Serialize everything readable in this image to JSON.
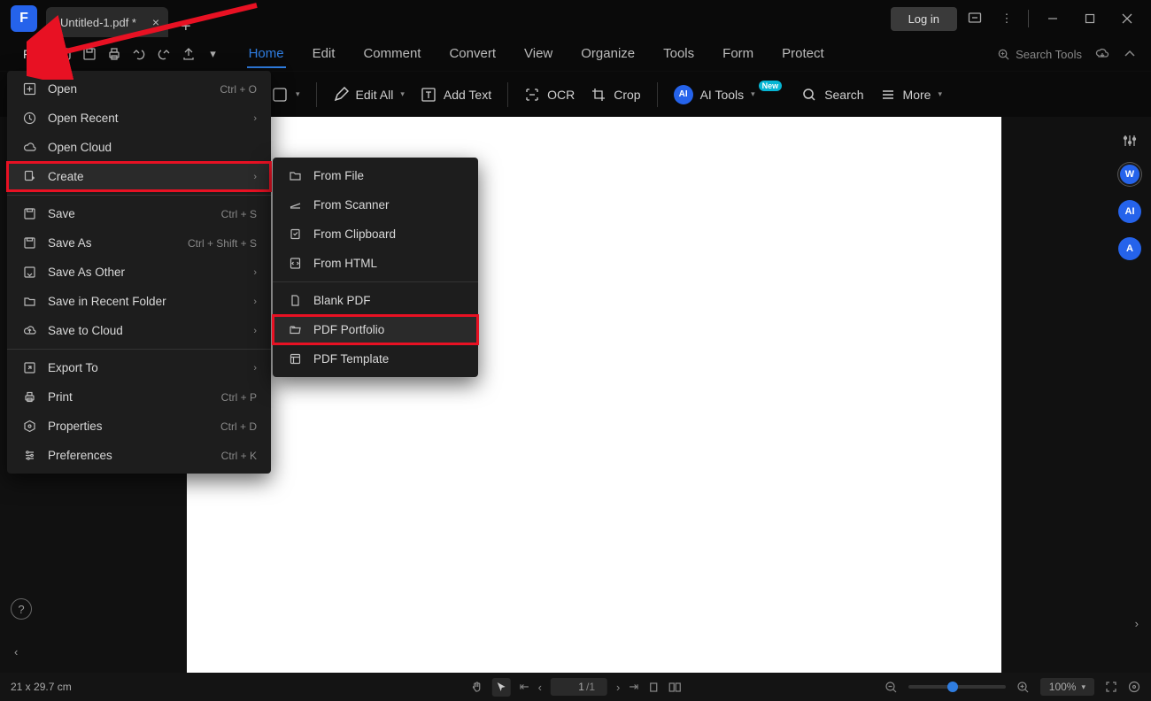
{
  "app": {
    "logo_letter": "F"
  },
  "tab": {
    "title": "Untitled-1.pdf *"
  },
  "titlebar": {
    "login": "Log in"
  },
  "menu": {
    "file": "File"
  },
  "ribbon": {
    "home": "Home",
    "edit": "Edit",
    "comment": "Comment",
    "convert": "Convert",
    "view": "View",
    "organize": "Organize",
    "tools": "Tools",
    "form": "Form",
    "protect": "Protect"
  },
  "search": {
    "placeholder": "Search Tools"
  },
  "toolbar": {
    "edit_all": "Edit All",
    "add_text": "Add Text",
    "ocr": "OCR",
    "crop": "Crop",
    "ai_tools": "AI Tools",
    "new_badge": "New",
    "search": "Search",
    "more": "More"
  },
  "file_menu": {
    "open": {
      "label": "Open",
      "shortcut": "Ctrl + O"
    },
    "open_recent": {
      "label": "Open Recent"
    },
    "open_cloud": {
      "label": "Open Cloud"
    },
    "create": {
      "label": "Create"
    },
    "save": {
      "label": "Save",
      "shortcut": "Ctrl + S"
    },
    "save_as": {
      "label": "Save As",
      "shortcut": "Ctrl + Shift + S"
    },
    "save_as_other": {
      "label": "Save As Other"
    },
    "save_recent_folder": {
      "label": "Save in Recent Folder"
    },
    "save_cloud": {
      "label": "Save to Cloud"
    },
    "export_to": {
      "label": "Export To"
    },
    "print": {
      "label": "Print",
      "shortcut": "Ctrl + P"
    },
    "properties": {
      "label": "Properties",
      "shortcut": "Ctrl + D"
    },
    "preferences": {
      "label": "Preferences",
      "shortcut": "Ctrl + K"
    }
  },
  "create_menu": {
    "from_file": "From File",
    "from_scanner": "From Scanner",
    "from_clipboard": "From Clipboard",
    "from_html": "From HTML",
    "blank_pdf": "Blank PDF",
    "pdf_portfolio": "PDF Portfolio",
    "pdf_template": "PDF Template"
  },
  "status": {
    "dimensions": "21 x 29.7 cm",
    "page_current": "1",
    "page_total": "/1",
    "zoom": "100%"
  },
  "right_panel": {
    "w": "W",
    "ai": "AI",
    "at": "A"
  }
}
